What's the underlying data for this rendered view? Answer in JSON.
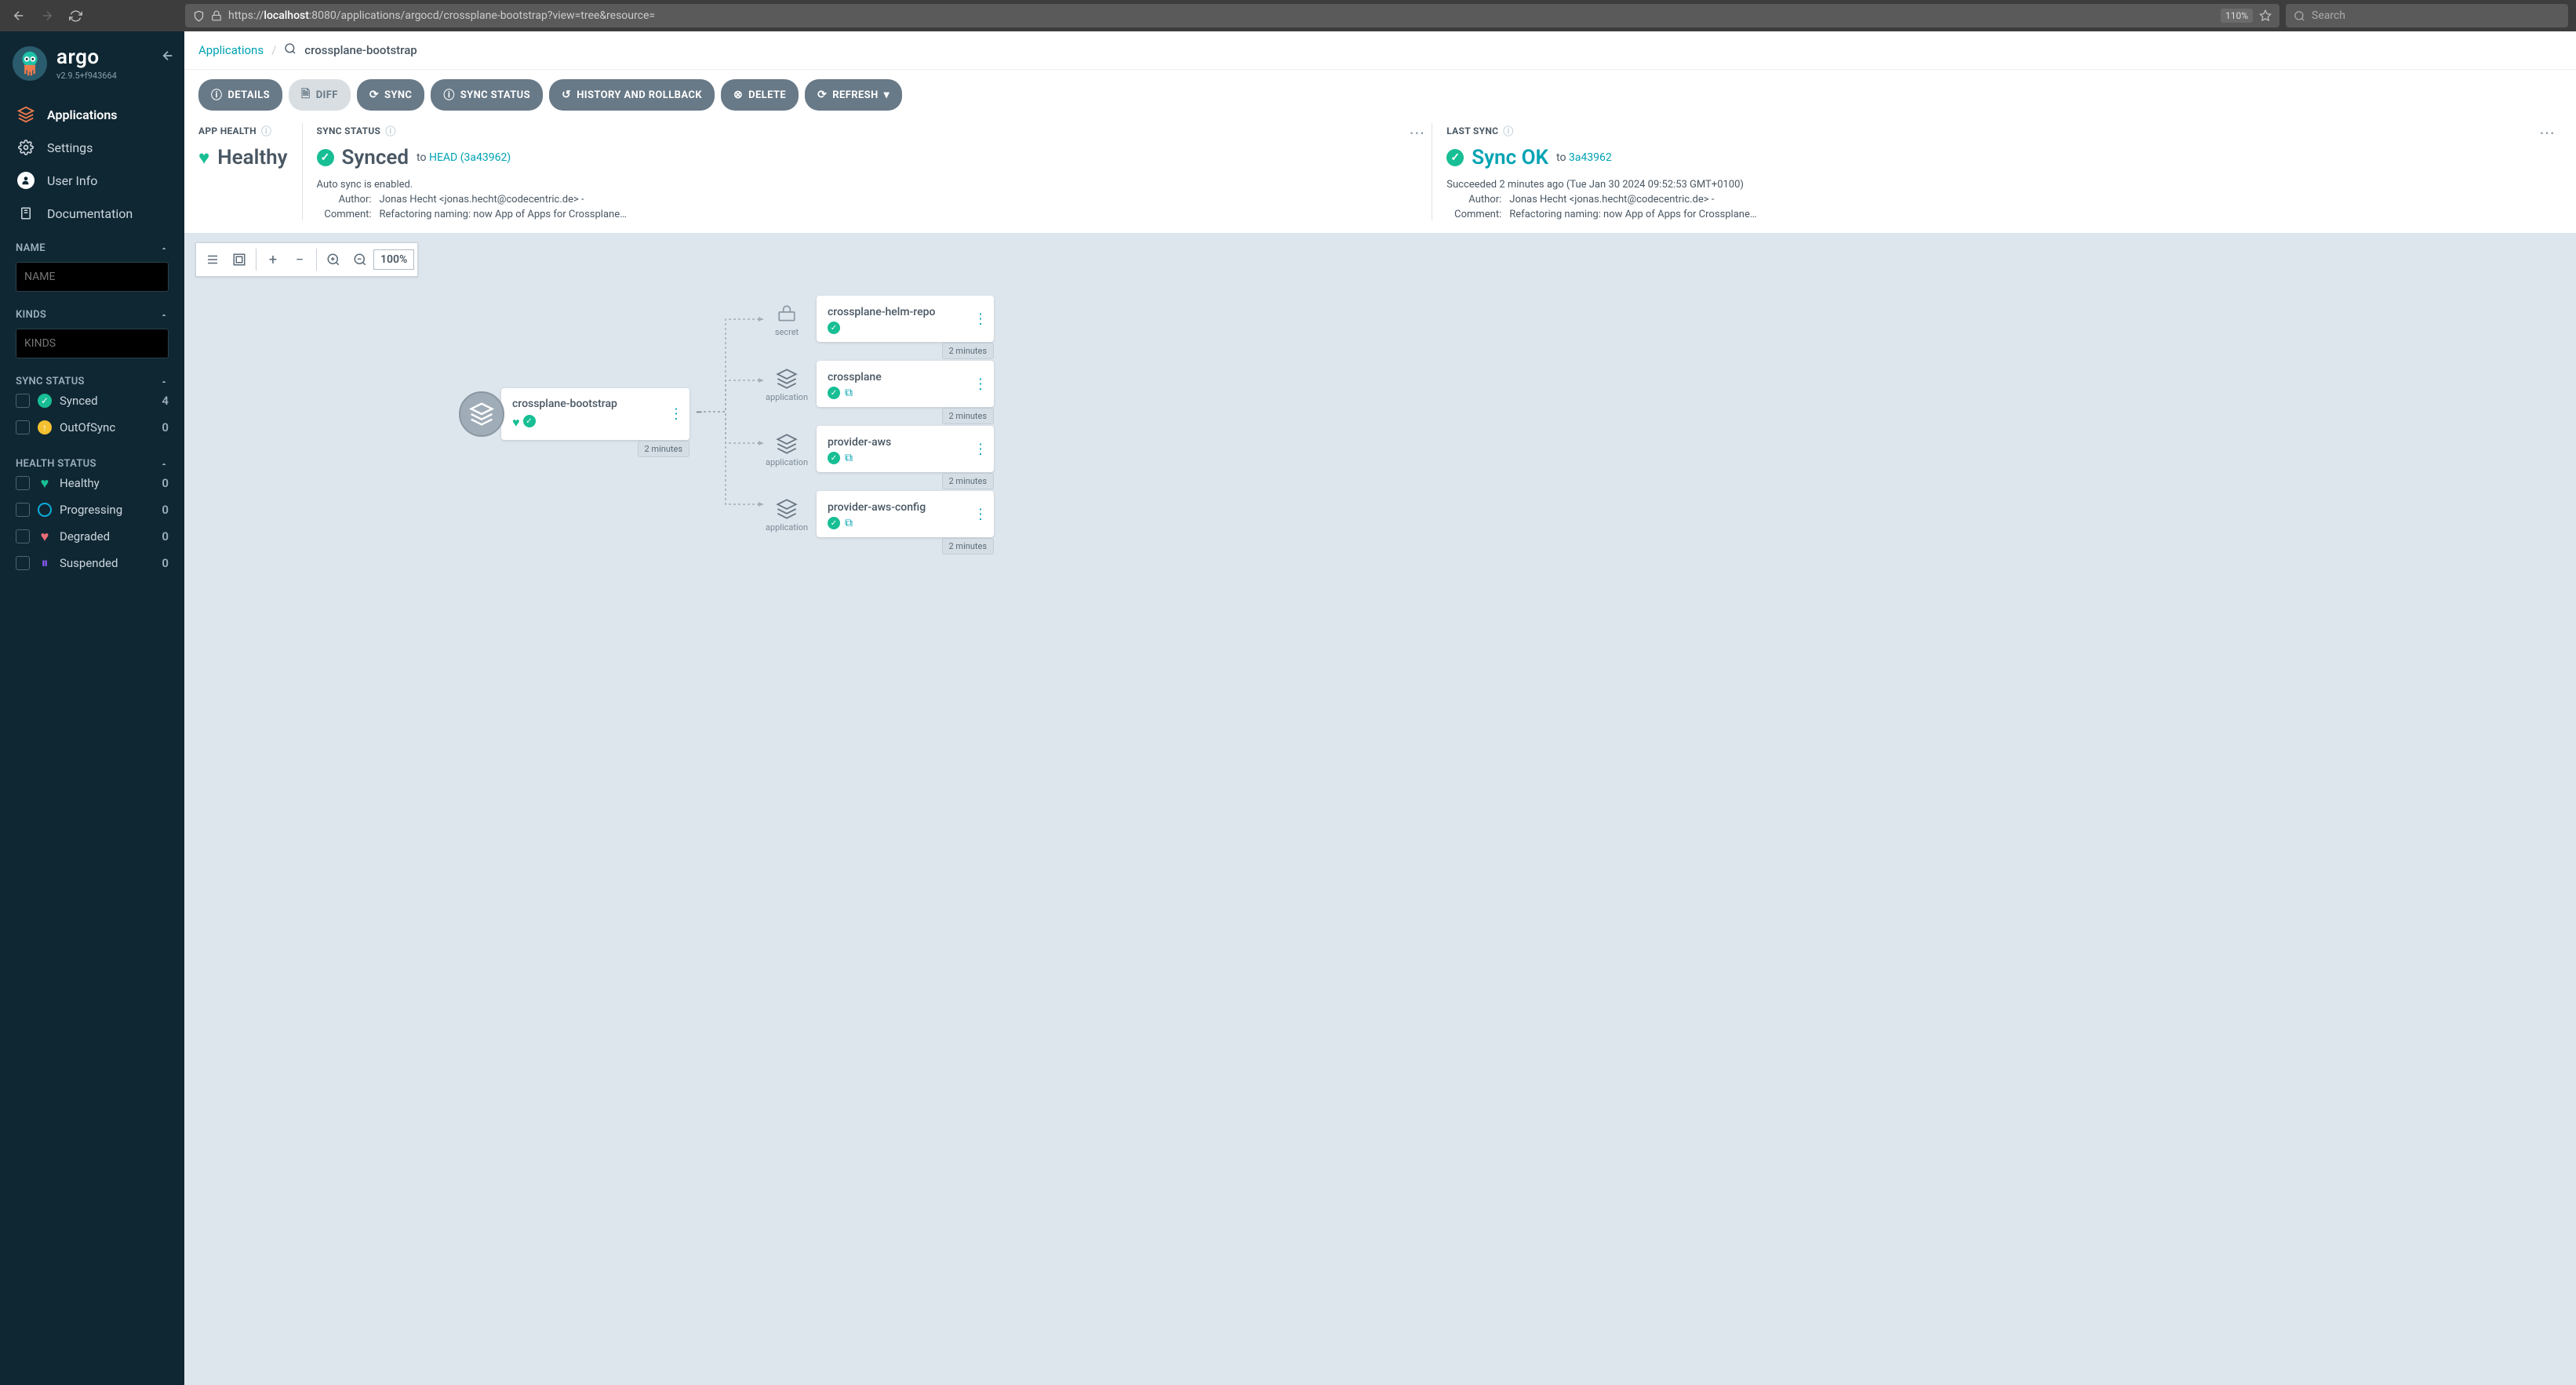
{
  "browser": {
    "url_prefix": "https://",
    "url_host": "localhost",
    "url_rest": ":8080/applications/argocd/crossplane-bootstrap?view=tree&resource=",
    "zoom": "110%",
    "search_placeholder": "Search"
  },
  "brand": {
    "name": "argo",
    "version": "v2.9.5+f943664"
  },
  "nav": {
    "applications": "Applications",
    "settings": "Settings",
    "user_info": "User Info",
    "documentation": "Documentation"
  },
  "filters": {
    "name_label": "NAME",
    "name_placeholder": "NAME",
    "kinds_label": "KINDS",
    "kinds_placeholder": "KINDS",
    "sync_status_label": "SYNC STATUS",
    "sync_rows": [
      {
        "label": "Synced",
        "count": "4"
      },
      {
        "label": "OutOfSync",
        "count": "0"
      }
    ],
    "health_status_label": "HEALTH STATUS",
    "health_rows": [
      {
        "label": "Healthy",
        "count": "0"
      },
      {
        "label": "Progressing",
        "count": "0"
      },
      {
        "label": "Degraded",
        "count": "0"
      },
      {
        "label": "Suspended",
        "count": "0"
      }
    ]
  },
  "breadcrumb": {
    "applications": "Applications",
    "current": "crossplane-bootstrap"
  },
  "toolbar": {
    "details": "DETAILS",
    "diff": "DIFF",
    "sync": "SYNC",
    "sync_status": "SYNC STATUS",
    "history": "HISTORY AND ROLLBACK",
    "delete": "DELETE",
    "refresh": "REFRESH"
  },
  "summary": {
    "health_title": "APP HEALTH",
    "health_value": "Healthy",
    "sync_title": "SYNC STATUS",
    "sync_value": "Synced",
    "sync_to": "to",
    "sync_rev": "HEAD (3a43962)",
    "auto_sync": "Auto sync is enabled.",
    "author_label": "Author:",
    "author_value": "Jonas Hecht <jonas.hecht@codecentric.de> -",
    "comment_label": "Comment:",
    "comment_value": "Refactoring naming: now App of Apps for Crossplane…",
    "last_sync_title": "LAST SYNC",
    "last_sync_value": "Sync OK",
    "last_sync_to": "to",
    "last_sync_rev": "3a43962",
    "last_sync_meta": "Succeeded 2 minutes ago (Tue Jan 30 2024 09:52:53 GMT+0100)",
    "last_author_value": "Jonas Hecht <jonas.hecht@codecentric.de> -",
    "last_comment_value": "Refactoring naming: now App of Apps for Crossplane…"
  },
  "zoom_level": "100%",
  "tree": {
    "root": {
      "name": "crossplane-bootstrap",
      "age": "2 minutes"
    },
    "children": [
      {
        "name": "crossplane-helm-repo",
        "kind": "secret",
        "age": "2 minutes",
        "has_link": false
      },
      {
        "name": "crossplane",
        "kind": "application",
        "age": "2 minutes",
        "has_link": true
      },
      {
        "name": "provider-aws",
        "kind": "application",
        "age": "2 minutes",
        "has_link": true
      },
      {
        "name": "provider-aws-config",
        "kind": "application",
        "age": "2 minutes",
        "has_link": true
      }
    ]
  }
}
